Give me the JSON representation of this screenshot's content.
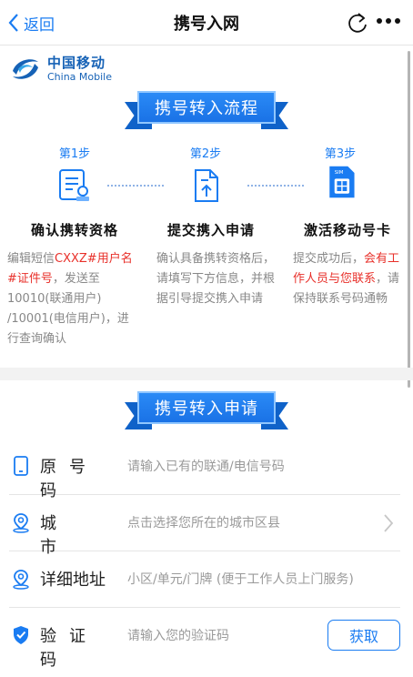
{
  "nav": {
    "back_label": "返回",
    "title": "携号入网"
  },
  "brand": {
    "name_cn": "中国移动",
    "name_en": "China Mobile"
  },
  "process_banner": "携号转入流程",
  "steps": [
    {
      "label": "第1步",
      "title": "确认携转资格",
      "desc_parts": [
        "编辑短信",
        "CXXZ#用户名#证件号",
        "，发送至10010(联通用户) /10001(电信用户)，进行查询确认"
      ]
    },
    {
      "label": "第2步",
      "title": "提交携入申请",
      "desc_parts": [
        "确认具备携转资格后，请填写下方信息，并根据引导提交携入申请"
      ]
    },
    {
      "label": "第3步",
      "title": "激活移动号卡",
      "desc_parts": [
        "提交成功后，",
        "会有工作人员与您联系",
        "，请保持联系号码通畅"
      ]
    }
  ],
  "apply_banner": "携号转入申请",
  "form": {
    "phone": {
      "label": "原号码",
      "placeholder": "请输入已有的联通/电信号码"
    },
    "city": {
      "label": "城市",
      "placeholder": "点击选择您所在的城市区县"
    },
    "address": {
      "label": "详细地址",
      "placeholder": "小区/单元/门牌 (便于工作人员上门服务)"
    },
    "code": {
      "label": "验证码",
      "placeholder": "请输入您的验证码",
      "button": "获取"
    }
  },
  "colors": {
    "accent": "#1a7cf2",
    "highlight": "#e8302a",
    "brand": "#1662b6"
  }
}
